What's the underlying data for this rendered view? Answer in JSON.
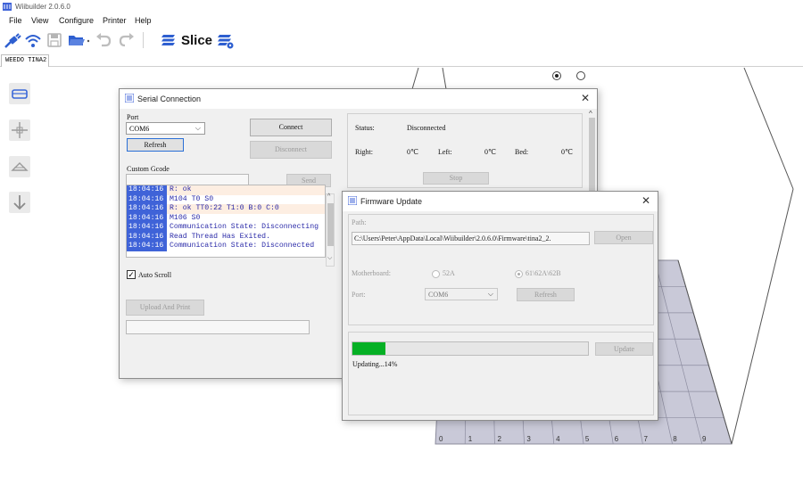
{
  "window": {
    "title": "Wiibuilder 2.0.6.0"
  },
  "menu": [
    "File",
    "View",
    "Configure",
    "Printer",
    "Help"
  ],
  "toolbar": {
    "icons": [
      "connect-icon",
      "wifi-icon",
      "save-icon",
      "open-icon",
      "undo-icon",
      "redo-icon",
      "slice-icon",
      "slice-settings-icon"
    ],
    "slice_label": "Slice"
  },
  "tabs": [
    "WEEDO TINA2"
  ],
  "left_tools": [
    "platform-icon",
    "move-icon",
    "rotate-icon",
    "drop-icon"
  ],
  "view_radios": [
    {
      "selected": true
    },
    {
      "selected": false
    }
  ],
  "plate": {
    "ruler": [
      "0",
      "1",
      "2",
      "3",
      "4",
      "5",
      "6",
      "7",
      "8",
      "9"
    ]
  },
  "serial": {
    "title": "Serial Connection",
    "port_label": "Port",
    "port_value": "COM6",
    "connect": "Connect",
    "disconnect": "Disconnect",
    "refresh": "Refresh",
    "custom_label": "Custom Gcode",
    "send": "Send",
    "status_label": "Status:",
    "status_value": "Disconnected",
    "right_label": "Right:",
    "right_value": "0℃",
    "left_label": "Left:",
    "left_value": "0℃",
    "bed_label": "Bed:",
    "bed_value": "0℃",
    "stop": "Stop",
    "log": [
      {
        "time": "18:04:16",
        "msg": "R: ok",
        "alt": true
      },
      {
        "time": "18:04:16",
        "msg": "M104 T0 S0",
        "alt": false
      },
      {
        "time": "18:04:16",
        "msg": "R: ok TT0:22 T1:0 B:0 C:0",
        "alt": true
      },
      {
        "time": "18:04:16",
        "msg": "M106 S0",
        "alt": false
      },
      {
        "time": "18:04:16",
        "msg": "Communication State: Disconnecting",
        "alt": false
      },
      {
        "time": "18:04:16",
        "msg": "Read Thread Has Exited.",
        "alt": false
      },
      {
        "time": "18:04:16",
        "msg": "Communication State: Disconnected",
        "alt": false
      }
    ],
    "autoscroll": "Auto Scroll",
    "upload": "Upload And Print"
  },
  "firmware": {
    "title": "Firmware Update",
    "path_label": "Path:",
    "path_value": "C:\\Users\\Peter\\AppData\\Local\\Wiibuilder\\2.0.6.0\\Firmware\\tina2_2.",
    "open": "Open",
    "motherboard_label": "Motherboard:",
    "mb_option1": "52A",
    "mb_option2": "61\\62A\\62B",
    "port_label": "Port:",
    "port_value": "COM6",
    "refresh": "Refresh",
    "update": "Update",
    "progress": 0.14,
    "progress_text": "Updating...14%"
  },
  "colors": {
    "accent": "#3f63d8",
    "progress": "#06b025",
    "plate": "#c9c9d8"
  }
}
